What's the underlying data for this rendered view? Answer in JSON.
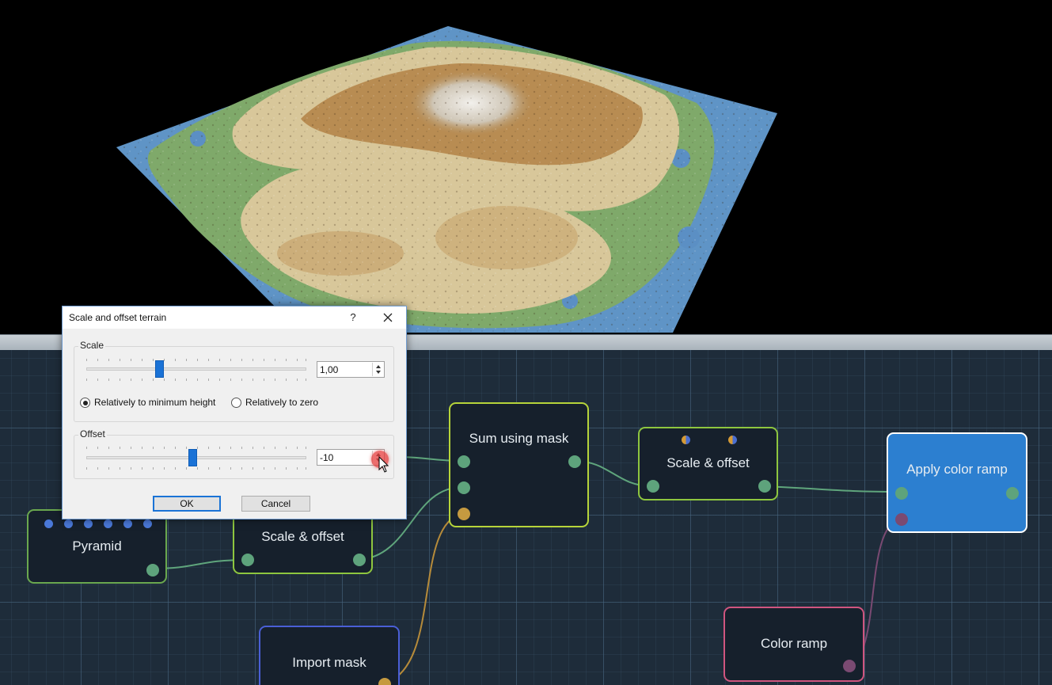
{
  "dialog": {
    "title": "Scale and offset terrain",
    "help_label": "?",
    "scale_group_label": "Scale",
    "scale_value": "1,00",
    "radio_min_label": "Relatively to minimum height",
    "radio_zero_label": "Relatively to zero",
    "radio_selected": "min",
    "offset_group_label": "Offset",
    "offset_value": "-10",
    "ok_label": "OK",
    "cancel_label": "Cancel"
  },
  "nodes": {
    "pyramid": "Pyramid",
    "scale_offset_1": "Scale & offset",
    "sum_mask": "Sum using mask",
    "scale_offset_2": "Scale & offset",
    "apply_ramp": "Apply color ramp",
    "import_mask": "Import mask",
    "color_ramp": "Color ramp"
  },
  "colors": {
    "node_border_green": "#8ec63f",
    "node_border_lime": "#b6d43a",
    "node_border_blue": "#4a5fd6",
    "node_border_pink": "#d0557f",
    "node_selected_fill": "#2c7fd0",
    "port_green": "#5ea37c",
    "port_gold": "#c59a40",
    "wire_green": "#5fa57c",
    "wire_gold": "#b68b3a",
    "wire_purple": "#7a4a72"
  },
  "icons": [
    "close-icon",
    "spin-up-icon",
    "spin-down-icon",
    "mouse-cursor-icon"
  ]
}
